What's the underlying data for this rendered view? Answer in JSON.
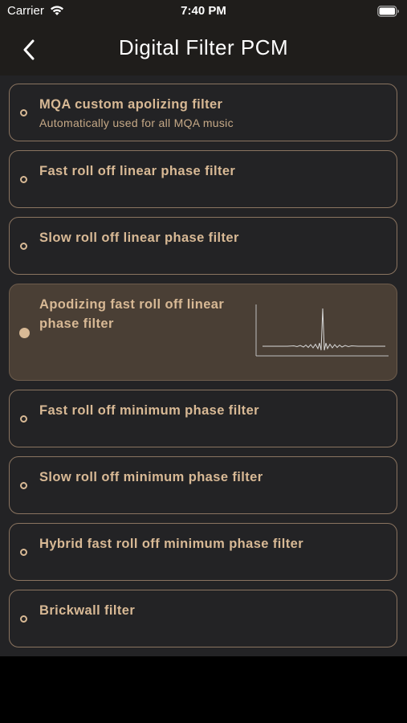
{
  "status_bar": {
    "carrier": "Carrier",
    "time": "7:40 PM"
  },
  "nav": {
    "title": "Digital Filter PCM",
    "back_icon": "chevron-left-icon"
  },
  "colors": {
    "accent": "#d8b995",
    "border": "#8a7460",
    "selected_bg": "#4a3f35",
    "list_bg": "#232325",
    "header_bg": "#1f1d1b"
  },
  "options": [
    {
      "label": "MQA custom apolizing filter",
      "subtitle": "Automatically used for all MQA music",
      "selected": false
    },
    {
      "label": "Fast roll off linear phase filter",
      "selected": false
    },
    {
      "label": "Slow roll off linear phase filter",
      "selected": false
    },
    {
      "label_line1": "Apodizing fast roll off linear",
      "label_line2": "phase filter",
      "selected": true,
      "preview_icon": "impulse-response-graph-icon"
    },
    {
      "label": "Fast roll off minimum phase filter",
      "selected": false
    },
    {
      "label": "Slow roll off minimum phase filter",
      "selected": false
    },
    {
      "label": "Hybrid fast roll off minimum phase filter",
      "selected": false
    },
    {
      "label": "Brickwall filter",
      "selected": false
    }
  ]
}
